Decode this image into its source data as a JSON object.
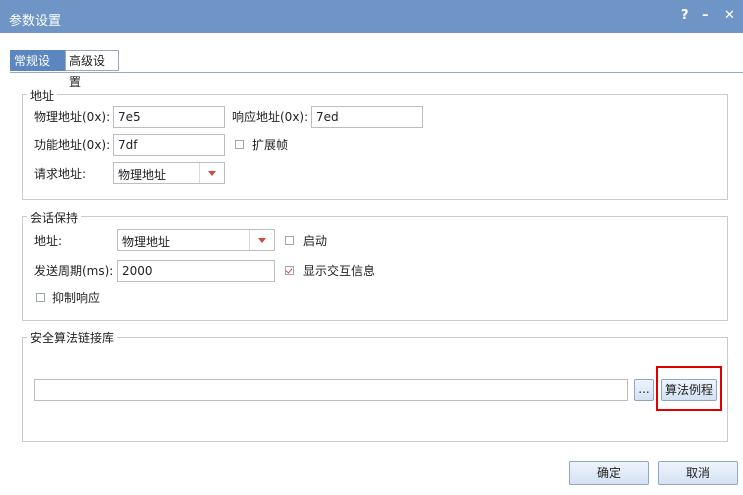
{
  "window": {
    "title": "参数设置",
    "help": "?",
    "minimize": "–",
    "close": "✕"
  },
  "tabs": [
    {
      "label": "常规设置",
      "active": true
    },
    {
      "label": "高级设置",
      "active": false
    }
  ],
  "address": {
    "legend": "地址",
    "physical_label": "物理地址(0x):",
    "physical_value": "7e5",
    "response_label": "响应地址(0x):",
    "response_value": "7ed",
    "functional_label": "功能地址(0x):",
    "functional_value": "7df",
    "extended_frame_label": "扩展帧",
    "extended_frame_checked": false,
    "request_label": "请求地址:",
    "request_value": "物理地址"
  },
  "session": {
    "legend": "会话保持",
    "address_label": "地址:",
    "address_value": "物理地址",
    "enable_label": "启动",
    "enable_checked": false,
    "period_label": "发送周期(ms):",
    "period_value": "2000",
    "show_info_label": "显示交互信息",
    "show_info_checked": true,
    "suppress_label": "抑制响应",
    "suppress_checked": false
  },
  "security": {
    "legend": "安全算法链接库",
    "path_value": "",
    "browse_label": "...",
    "example_label": "算法例程"
  },
  "footer": {
    "ok_label": "确定",
    "cancel_label": "取消"
  },
  "colors": {
    "titlebar": "#6f95c7",
    "tab_active": "#5b86c0",
    "highlight": "#e00000",
    "check_mark": "#d14b3a"
  }
}
